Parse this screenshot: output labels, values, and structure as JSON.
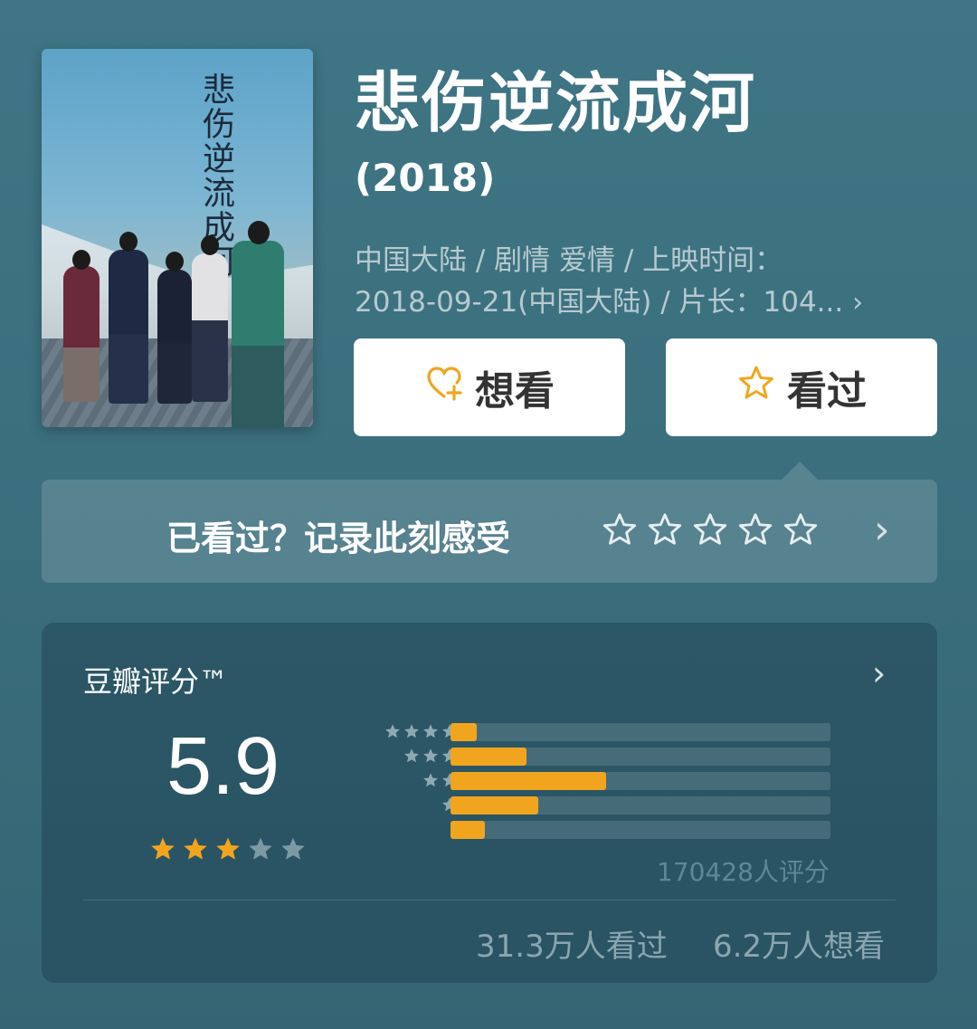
{
  "movie": {
    "title": "悲伤逆流成河",
    "year": "(2018)",
    "meta_line1": "中国大陆 / 剧情 爱情 / 上映时间：",
    "meta_line2": "2018-09-21(中国大陆) / 片长：104...",
    "meta_more_icon": "chevron-right-icon",
    "poster": {
      "title_text": "悲伤逆流成河"
    }
  },
  "actions": {
    "want_label": "想看",
    "want_icon": "heart-plus-icon",
    "seen_label": "看过",
    "seen_icon": "star-outline-icon",
    "accent_color": "#f1a51f"
  },
  "record": {
    "prompt": "已看过？记录此刻感受",
    "stars_count": 5,
    "arrow_icon": "chevron-right-icon"
  },
  "rating": {
    "label": "豆瓣评分™",
    "score": "5.9",
    "stars_filled": 3,
    "stars_total": 5,
    "distribution": [
      {
        "stars": 5,
        "fraction": 0.07
      },
      {
        "stars": 4,
        "fraction": 0.2
      },
      {
        "stars": 3,
        "fraction": 0.41
      },
      {
        "stars": 2,
        "fraction": 0.23
      },
      {
        "stars": 1,
        "fraction": 0.09
      }
    ],
    "total_ratings": "170428人评分",
    "watched": "31.3万人看过",
    "want_to_watch": "6.2万人想看"
  }
}
